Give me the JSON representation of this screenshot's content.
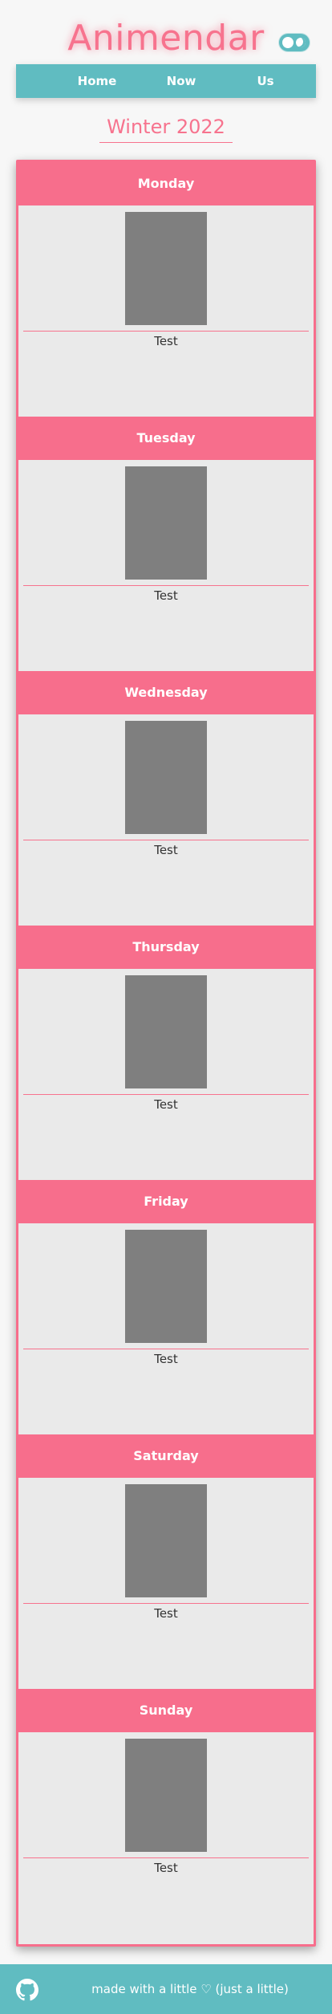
{
  "app": {
    "title": "Animendar",
    "accent_color": "#f7738e",
    "secondary_color": "#60bcc1",
    "theme_toggle_icon": "theme-toggle-icon"
  },
  "nav": {
    "items": [
      {
        "label": "Home"
      },
      {
        "label": "Now"
      },
      {
        "label": "Us"
      }
    ]
  },
  "season": {
    "label": "Winter 2022"
  },
  "schedule": {
    "days": [
      {
        "name": "Monday",
        "anime": [
          {
            "title": "Test"
          }
        ]
      },
      {
        "name": "Tuesday",
        "anime": [
          {
            "title": "Test"
          }
        ]
      },
      {
        "name": "Wednesday",
        "anime": [
          {
            "title": "Test"
          }
        ]
      },
      {
        "name": "Thursday",
        "anime": [
          {
            "title": "Test"
          }
        ]
      },
      {
        "name": "Friday",
        "anime": [
          {
            "title": "Test"
          }
        ]
      },
      {
        "name": "Saturday",
        "anime": [
          {
            "title": "Test"
          }
        ]
      },
      {
        "name": "Sunday",
        "anime": [
          {
            "title": "Test"
          }
        ]
      }
    ]
  },
  "footer": {
    "icon": "github-icon",
    "text": "made with a little ♡ (just a little)"
  }
}
